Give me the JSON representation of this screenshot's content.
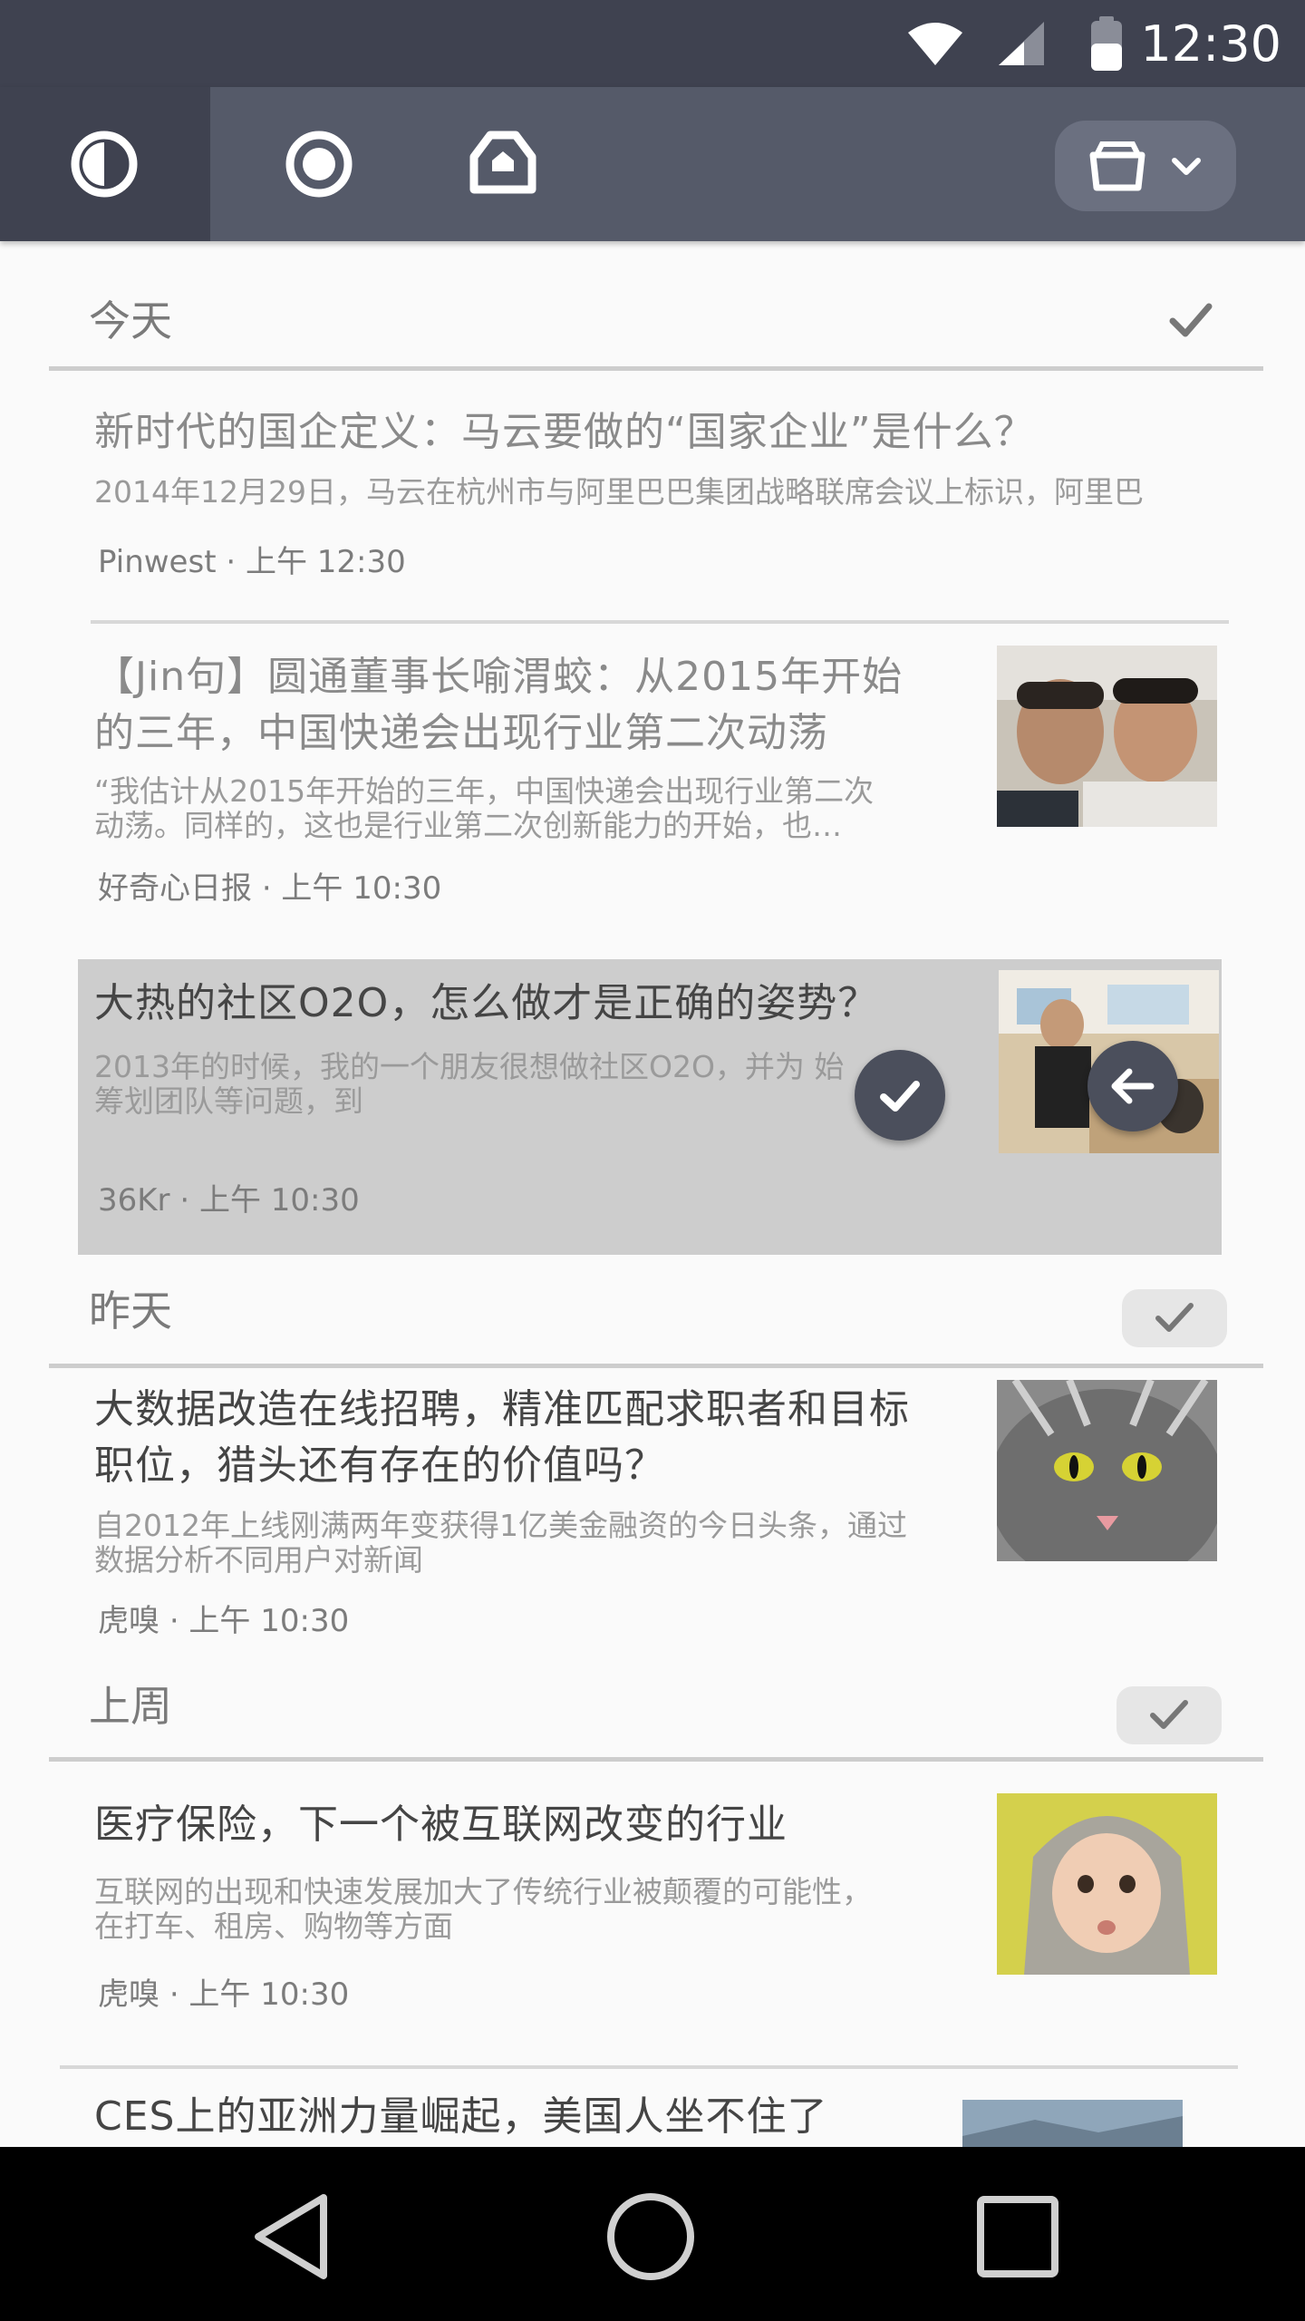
{
  "status_bar": {
    "time": "12:30"
  },
  "toolbar": {
    "tabs": [
      {
        "icon": "half-circle-icon",
        "active": true
      },
      {
        "icon": "target-icon",
        "active": false
      },
      {
        "icon": "inbox-icon",
        "active": false
      }
    ],
    "folder_menu": {
      "icon": "folder-icon",
      "dropdown_icon": "chevron-down-icon"
    }
  },
  "sections": {
    "today": {
      "title": "今天"
    },
    "yesterday": {
      "title": "昨天"
    },
    "last_week": {
      "title": "上周"
    }
  },
  "articles": [
    {
      "title": "新时代的国企定义：马云要做的“国家企业”是什么？",
      "summary": "2014年12月29日，马云在杭州市与阿里巴巴集团战略联席会议上标识，阿里巴",
      "source": "Pinwest",
      "time": "· 上午 12:30"
    },
    {
      "title_line1": "【Jin句】圆通董事长喻渭蛟：从2015年开始",
      "title_line2": "的三年，中国快递会出现行业第二次动荡",
      "summary_line1": "“我估计从2015年开始的三年，中国快递会出现行业第二次",
      "summary_line2": "动荡。同样的，这也是行业第二次创新能力的开始，也…",
      "source": "好奇心日报",
      "time": "· 上午 10:30"
    },
    {
      "title": "大热的社区O2O，怎么做才是正确的姿势？",
      "summary_line1": "2013年的时候，我的一个朋友很想做社区O2O，并为      始",
      "summary_line2": "筹划团队等问题，到",
      "source": "36Kr",
      "time": "· 上午 10:30"
    },
    {
      "title_line1": "大数据改造在线招聘，精准匹配求职者和目标",
      "title_line2": "职位，猎头还有存在的价值吗？",
      "summary_line1": "自2012年上线刚满两年变获得1亿美金融资的今日头条，通过",
      "summary_line2": "数据分析不同用户对新闻",
      "source": "虎嗅",
      "time": "· 上午 10:30"
    },
    {
      "title": "医疗保险，下一个被互联网改变的行业",
      "summary_line1": "互联网的出现和快速发展加大了传统行业被颠覆的可能性，",
      "summary_line2": "在打车、租房、购物等方面",
      "source": "虎嗅",
      "time": "· 上午 10:30"
    },
    {
      "title": "CES上的亚洲力量崛起，美国人坐不住了"
    }
  ],
  "swipe_actions": {
    "mark_read_icon": "check-icon",
    "undo_icon": "arrow-left-icon"
  },
  "nav_bar": {
    "back_icon": "back-triangle-icon",
    "home_icon": "home-circle-icon",
    "recents_icon": "recents-square-icon"
  }
}
